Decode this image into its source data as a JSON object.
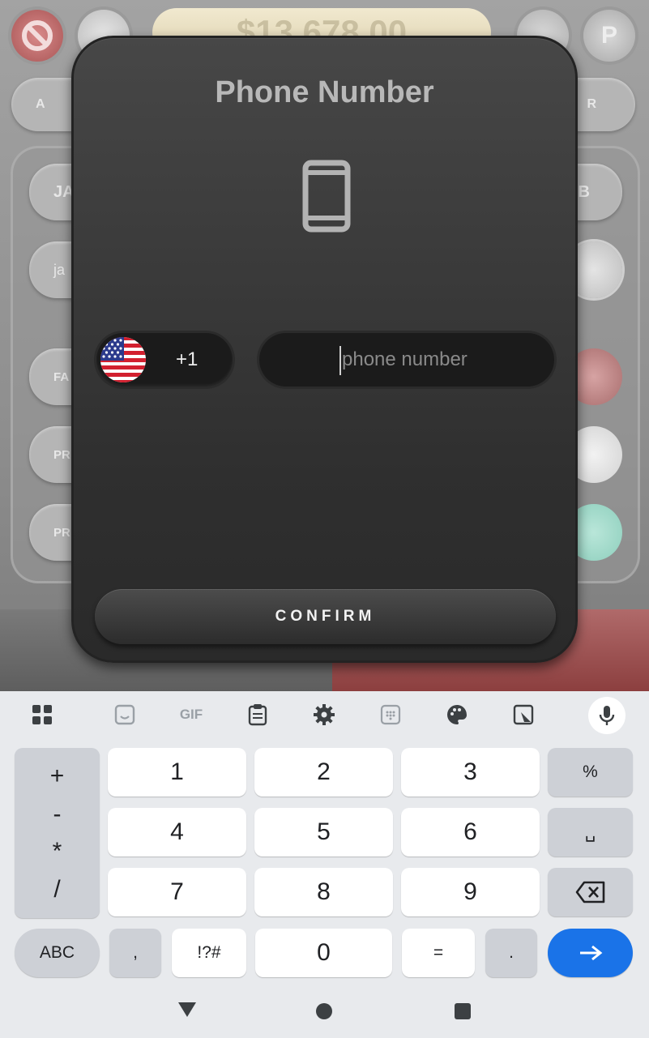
{
  "background": {
    "balance": "$13,678.00",
    "pill_labels": [
      "A",
      "R",
      "JA",
      "B",
      "ja",
      "FA",
      "PR",
      "PR"
    ]
  },
  "modal": {
    "title": "Phone Number",
    "country_dial_code": "+1",
    "phone_placeholder": "phone number",
    "phone_value": "",
    "confirm_label": "CONFIRM"
  },
  "keyboard": {
    "toolbar_icons": [
      "apps-grid-icon",
      "sticker-icon",
      "gif-icon",
      "clipboard-icon",
      "settings-gear-icon",
      "keypad-icon",
      "palette-icon",
      "floating-keyboard-icon",
      "microphone-icon"
    ],
    "toolbar_gif_label": "GIF",
    "ops": [
      "+",
      "-",
      "*",
      "/"
    ],
    "rows": [
      [
        "1",
        "2",
        "3"
      ],
      [
        "4",
        "5",
        "6"
      ],
      [
        "7",
        "8",
        "9"
      ]
    ],
    "percent": "%",
    "space": "␣",
    "abc": "ABC",
    "comma": ",",
    "symbols": "!?#",
    "zero": "0",
    "equals": "=",
    "period": ".",
    "enter_arrow": "→"
  },
  "colors": {
    "modal_bg": "#3a3a3a",
    "accent_blue": "#1a73e8",
    "keyboard_bg": "#e8eaed"
  }
}
